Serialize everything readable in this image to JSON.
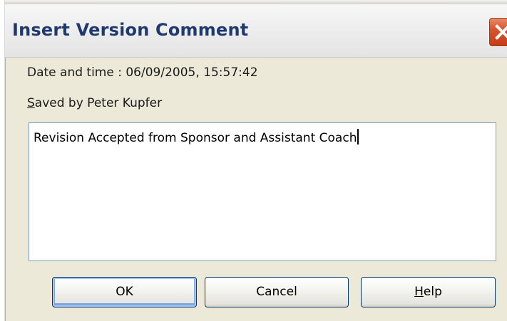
{
  "dialog": {
    "title": "Insert Version Comment",
    "date_label": "Date and time : 06/09/2005, 15:57:42",
    "saved_by_prefix": "S",
    "saved_by_rest": "aved by Peter Kupfer",
    "comment_text": "Revision Accepted from Sponsor and Assistant Coach",
    "buttons": {
      "ok": "OK",
      "cancel": "Cancel",
      "help_first": "H",
      "help_rest": "elp"
    }
  },
  "icons": {
    "close": "close-icon"
  },
  "colors": {
    "title_text": "#1f3970",
    "close_button": "#d8542e",
    "dialog_bg": "#ece9d8",
    "button_border": "#003c74",
    "field_border": "#7f9db9"
  }
}
